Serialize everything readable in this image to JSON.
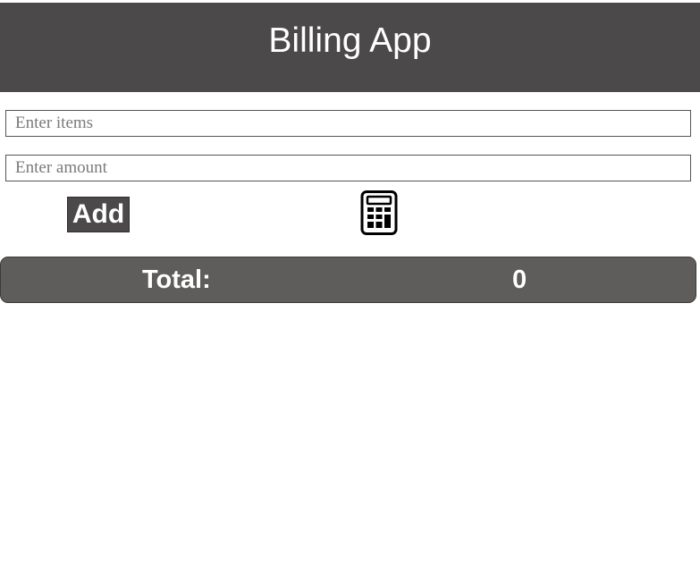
{
  "header": {
    "title": "Billing App"
  },
  "form": {
    "items_placeholder": "Enter items",
    "items_value": "",
    "amount_placeholder": "Enter amount",
    "amount_value": "",
    "add_label": "Add",
    "calculator_icon": "calculator-icon"
  },
  "total": {
    "label": "Total:",
    "value": "0"
  },
  "colors": {
    "header_bg": "#4b4949",
    "button_bg": "#4b4949",
    "total_bg": "#5f5d5b",
    "text_light": "#ffffff"
  }
}
